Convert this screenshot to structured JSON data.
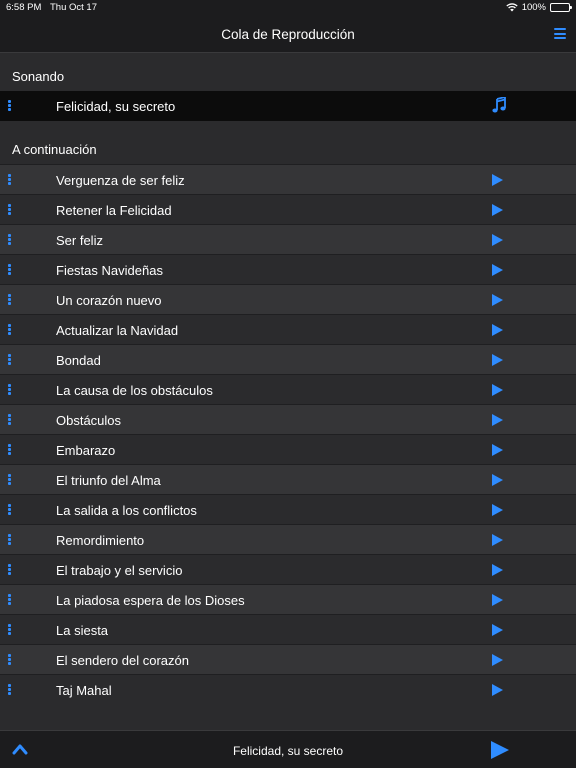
{
  "status_bar": {
    "time": "6:58 PM",
    "date": "Thu Oct 17",
    "battery": "100%"
  },
  "nav": {
    "title": "Cola de Reproducción",
    "menu_icon": "hamburger-menu-icon"
  },
  "now_playing": {
    "header": "Sonando",
    "track": "Felicidad, su secreto",
    "icon": "music-note-icon"
  },
  "up_next": {
    "header": "A continuación",
    "tracks": [
      "Verguenza de ser feliz",
      "Retener la Felicidad",
      "Ser feliz",
      "Fiestas Navideñas",
      "Un corazón nuevo",
      "Actualizar la Navidad",
      "Bondad",
      "La causa de los obstáculos",
      "Obstáculos",
      "Embarazo",
      "El triunfo del Alma",
      "La salida a los conflictos",
      "Remordimiento",
      "El trabajo y el servicio",
      "La piadosa espera de los Dioses",
      "La siesta",
      "El sendero del corazón",
      "Taj Mahal"
    ]
  },
  "toolbar": {
    "current_track": "Felicidad, su secreto"
  },
  "colors": {
    "accent": "#2f8cff",
    "background": "#2b2b2d",
    "row_alt": "#353537",
    "bar": "#1c1c1e"
  }
}
